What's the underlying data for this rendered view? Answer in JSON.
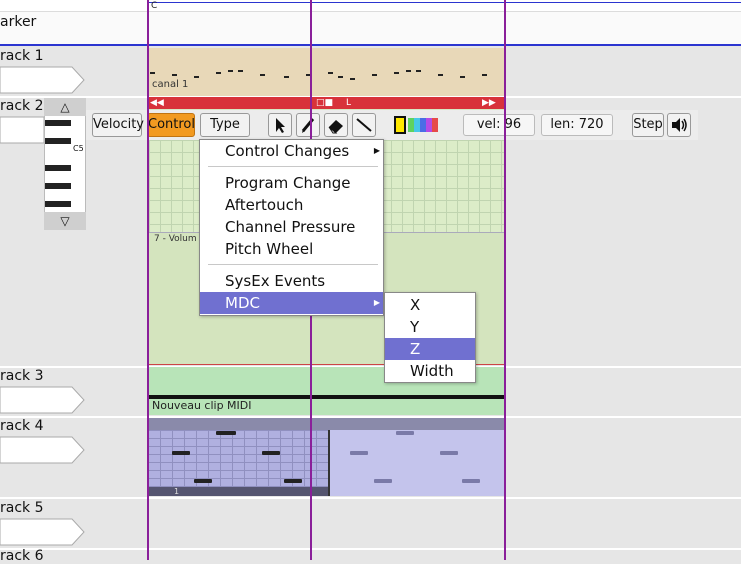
{
  "ruler": {
    "label": "C"
  },
  "marker": {
    "label": "arker"
  },
  "tracks": [
    {
      "name": "rack 1"
    },
    {
      "name": "rack 2"
    },
    {
      "name": "rack 3"
    },
    {
      "name": "rack 4"
    },
    {
      "name": "rack 5"
    },
    {
      "name": "rack 6"
    }
  ],
  "clips": {
    "track1": {
      "label": "canal 1"
    },
    "track2": {
      "controller_label": "7 - Volum"
    },
    "track3": {
      "label": "Nouveau clip MIDI"
    },
    "track4": {
      "footer_label": "1"
    }
  },
  "piano": {
    "c5_label": "C5"
  },
  "toolbar": {
    "velocity": "Velocity",
    "control": "Control",
    "type": "Type",
    "vel": "vel: 96",
    "len": "len: 720",
    "step": "Step"
  },
  "context_menu": {
    "items": [
      "Control Changes",
      "Program Change",
      "Aftertouch",
      "Channel Pressure",
      "Pitch Wheel",
      "SysEx Events",
      "MDC"
    ]
  },
  "submenu": {
    "items": [
      "X",
      "Y",
      "Z",
      "Width"
    ],
    "selected": "Z"
  },
  "colors": {
    "accent_orange": "#f29a21",
    "menu_highlight": "#7070d0",
    "playhead": "#8a1f9a",
    "clip_red": "#d8323a"
  }
}
